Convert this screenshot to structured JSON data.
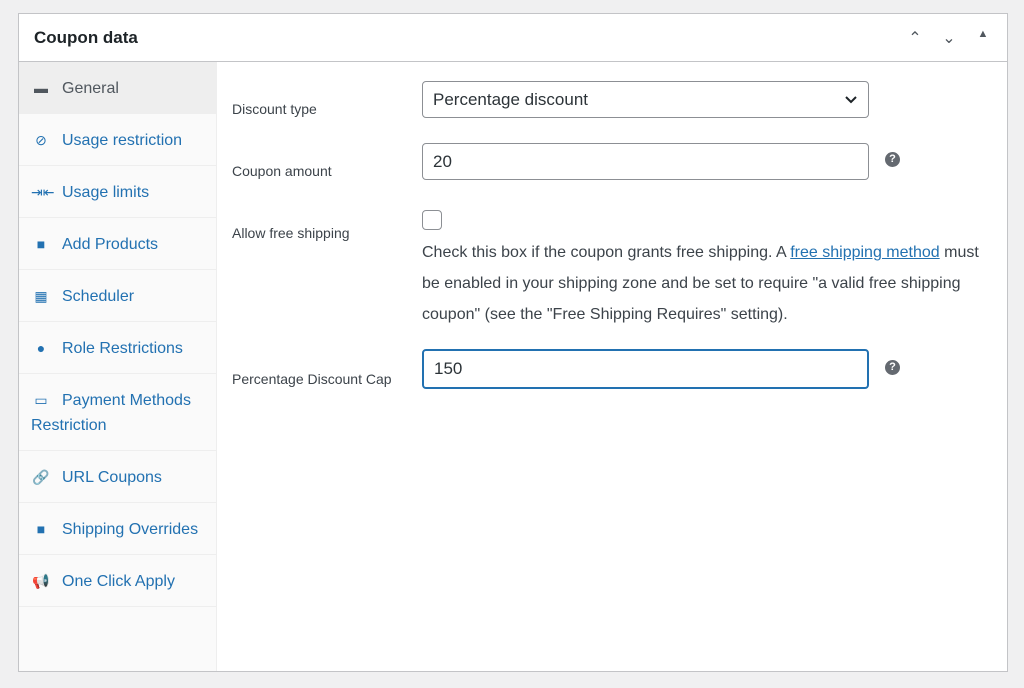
{
  "header": {
    "title": "Coupon data",
    "controls": [
      {
        "name": "move-up-icon",
        "glyph": "⌃"
      },
      {
        "name": "move-down-icon",
        "glyph": "⌄"
      },
      {
        "name": "collapse-icon",
        "glyph": "▲"
      }
    ]
  },
  "sidebar": {
    "items": [
      {
        "label": "General",
        "icon": "ticket-icon",
        "glyph": "▬",
        "active": true
      },
      {
        "label": "Usage restriction",
        "icon": "block-icon",
        "glyph": "⊘"
      },
      {
        "label": "Usage limits",
        "icon": "limits-icon",
        "glyph": "⇥⇤"
      },
      {
        "label": "Add Products",
        "icon": "bag-icon",
        "glyph": "■"
      },
      {
        "label": "Scheduler",
        "icon": "calendar-icon",
        "glyph": "▦"
      },
      {
        "label": "Role Restrictions",
        "icon": "user-icon",
        "glyph": "●"
      },
      {
        "label": "Payment Methods Restriction",
        "icon": "card-icon",
        "glyph": "▭"
      },
      {
        "label": "URL Coupons",
        "icon": "link-icon",
        "glyph": "🔗"
      },
      {
        "label": "Shipping Overrides",
        "icon": "truck-icon",
        "glyph": "■"
      },
      {
        "label": "One Click Apply",
        "icon": "megaphone-icon",
        "glyph": "📢"
      }
    ]
  },
  "form": {
    "discount_type": {
      "label": "Discount type",
      "value": "Percentage discount"
    },
    "coupon_amount": {
      "label": "Coupon amount",
      "value": "20",
      "help": "?"
    },
    "free_shipping": {
      "label": "Allow free shipping",
      "checked": false,
      "desc_pre": "Check this box if the coupon grants free shipping. A ",
      "link": "free shipping method",
      "desc_post": " must be enabled in your shipping zone and be set to require \"a valid free shipping coupon\" (see the \"Free Shipping Requires\" setting)."
    },
    "discount_cap": {
      "label": "Percentage Discount Cap",
      "value": "150",
      "help": "?"
    }
  }
}
